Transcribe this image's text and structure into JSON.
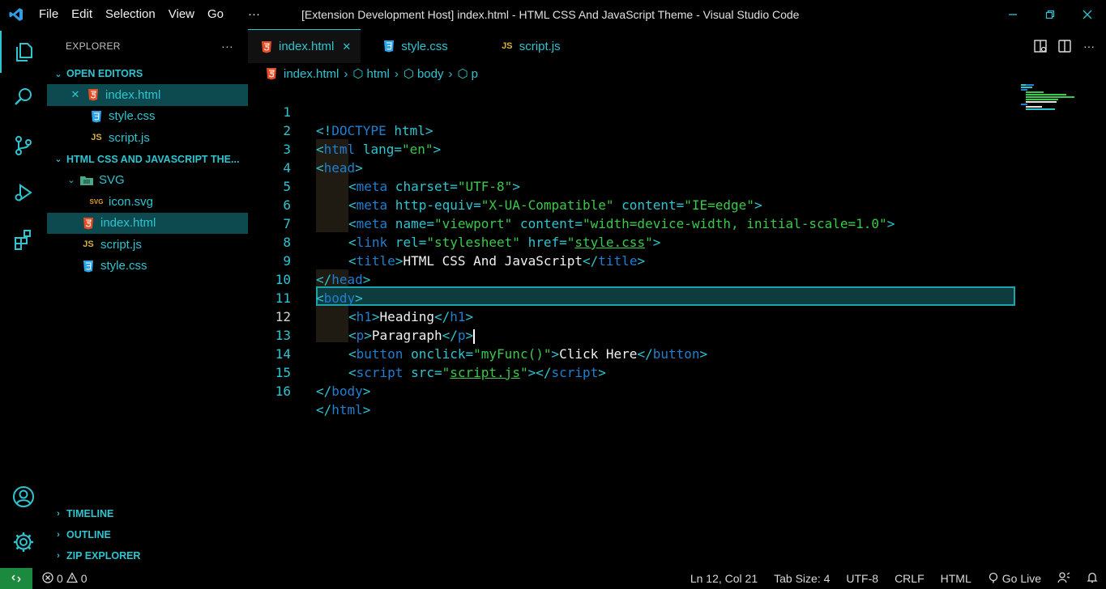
{
  "window": {
    "title": "[Extension Development Host] index.html - HTML CSS And JavaScript Theme - Visual Studio Code",
    "menu": [
      "File",
      "Edit",
      "Selection",
      "View",
      "Go",
      "···"
    ]
  },
  "sidebar": {
    "header": "EXPLORER",
    "more": "···",
    "open_editors_label": "OPEN EDITORS",
    "open_editors": [
      {
        "name": "index.html",
        "icon": "html-file-icon"
      },
      {
        "name": "style.css",
        "icon": "css-file-icon"
      },
      {
        "name": "script.js",
        "icon": "js-file-icon"
      }
    ],
    "project_label": "HTML CSS AND JAVASCRIPT THE...",
    "folder": "SVG",
    "folder_files": [
      {
        "name": "icon.svg",
        "icon": "svg-file-icon"
      }
    ],
    "files": [
      {
        "name": "index.html",
        "icon": "html-file-icon"
      },
      {
        "name": "script.js",
        "icon": "js-file-icon"
      },
      {
        "name": "style.css",
        "icon": "css-file-icon"
      }
    ],
    "bottom_sections": [
      "TIMELINE",
      "OUTLINE",
      "ZIP EXPLORER"
    ]
  },
  "tabs": [
    {
      "label": "index.html",
      "icon": "html-file-icon",
      "active": true
    },
    {
      "label": "style.css",
      "icon": "css-file-icon",
      "active": false
    },
    {
      "label": "script.js",
      "icon": "js-file-icon",
      "active": false
    }
  ],
  "breadcrumb": [
    "index.html",
    "html",
    "body",
    "p"
  ],
  "code_lines": [
    "1",
    "2",
    "3",
    "4",
    "5",
    "6",
    "7",
    "8",
    "9",
    "10",
    "11",
    "12",
    "13",
    "14",
    "15",
    "16"
  ],
  "code": {
    "l1": {
      "a": "<!",
      "b": "DOCTYPE",
      "c": " html",
      "d": ">"
    },
    "l2": {
      "a": "<",
      "b": "html",
      "c": " lang=",
      "d": "\"en\"",
      "e": ">"
    },
    "l3": {
      "a": "<",
      "b": "head",
      "c": ">"
    },
    "l4": {
      "a": "<",
      "b": "meta",
      "c": " charset=",
      "d": "\"UTF-8\"",
      "e": ">"
    },
    "l5": {
      "a": "<",
      "b": "meta",
      "c": " http-equiv=",
      "d": "\"X-UA-Compatible\"",
      "e": " content=",
      "f": "\"IE=edge\"",
      "g": ">"
    },
    "l6": {
      "a": "<",
      "b": "meta",
      "c": " name=",
      "d": "\"viewport\"",
      "e": " content=",
      "f": "\"width=device-width, initial-scale=1.0\"",
      "g": ">"
    },
    "l7": {
      "a": "<",
      "b": "link",
      "c": " rel=",
      "d": "\"stylesheet\"",
      "e": " href=",
      "f": "\"",
      "g": "style.css",
      "h": "\"",
      "i": ">"
    },
    "l8": {
      "a": "<",
      "b": "title",
      "c": ">",
      "d": "HTML CSS And JavaScript",
      "e": "</",
      "f": "title",
      "g": ">"
    },
    "l9": {
      "a": "</",
      "b": "head",
      "c": ">"
    },
    "l10": {
      "a": "<",
      "b": "body",
      "c": ">"
    },
    "l11": {
      "a": "<",
      "b": "h1",
      "c": ">",
      "d": "Heading",
      "e": "</",
      "f": "h1",
      "g": ">"
    },
    "l12": {
      "a": "<",
      "b": "p",
      "c": ">",
      "d": "Paragraph",
      "e": "</",
      "f": "p",
      "g": ">"
    },
    "l13": {
      "a": "<",
      "b": "button",
      "c": " onclick=",
      "d": "\"myFunc()\"",
      "e": ">",
      "f": "Click Here",
      "g": "</",
      "h": "button",
      "i": ">"
    },
    "l14": {
      "a": "<",
      "b": "script",
      "c": " src=",
      "d": "\"",
      "e": "script.js",
      "f": "\"",
      "g": "></",
      "h": "script",
      "i": ">"
    },
    "l15": {
      "a": "</",
      "b": "body",
      "c": ">"
    },
    "l16": {
      "a": "</",
      "b": "html",
      "c": ">"
    }
  },
  "status": {
    "errors": "0",
    "warnings": "0",
    "position": "Ln 12, Col 21",
    "tab_size": "Tab Size: 4",
    "encoding": "UTF-8",
    "eol": "CRLF",
    "language": "HTML",
    "go_live": "Go Live"
  },
  "colors": {
    "accent": "#2ec4d0",
    "keyword": "#1f7fd0",
    "string": "#3ac94b",
    "selection": "#0d4a4f",
    "remote": "#1c8a3e"
  }
}
